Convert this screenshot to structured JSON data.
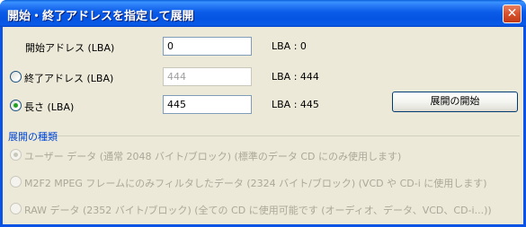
{
  "window": {
    "title": "開始・終了アドレスを指定して展開",
    "close_glyph": "✕"
  },
  "form": {
    "start_address": {
      "label": "開始アドレス (LBA)",
      "value": "0",
      "lba_readout": "LBA : 0"
    },
    "end_address": {
      "label": "終了アドレス (LBA)",
      "value": "444",
      "lba_readout": "LBA : 444",
      "selected": false
    },
    "length": {
      "label": "長さ (LBA)",
      "value": "445",
      "lba_readout": "LBA : 445",
      "selected": true
    },
    "start_button_label": "展開の開始"
  },
  "extract_type": {
    "group_title": "展開の種類",
    "options": [
      {
        "label": "ユーザー データ (通常 2048 バイト/ブロック) (標準のデータ CD にのみ使用します)",
        "selected": true,
        "enabled": false
      },
      {
        "label": "M2F2 MPEG フレームにのみフィルタしたデータ (2324 バイト/ブロック) (VCD や CD-i に使用します)",
        "selected": false,
        "enabled": false
      },
      {
        "label": "RAW データ (2352 バイト/ブロック) (全ての CD に使用可能です (オーディオ、データ、VCD、CD-i...))",
        "selected": false,
        "enabled": false
      }
    ]
  },
  "colors": {
    "titlebar": "#0a5ae8",
    "dialog_bg": "#ece9d8",
    "group_title": "#0046d5",
    "radio_checked": "#21a121",
    "close_button": "#d8512d"
  }
}
